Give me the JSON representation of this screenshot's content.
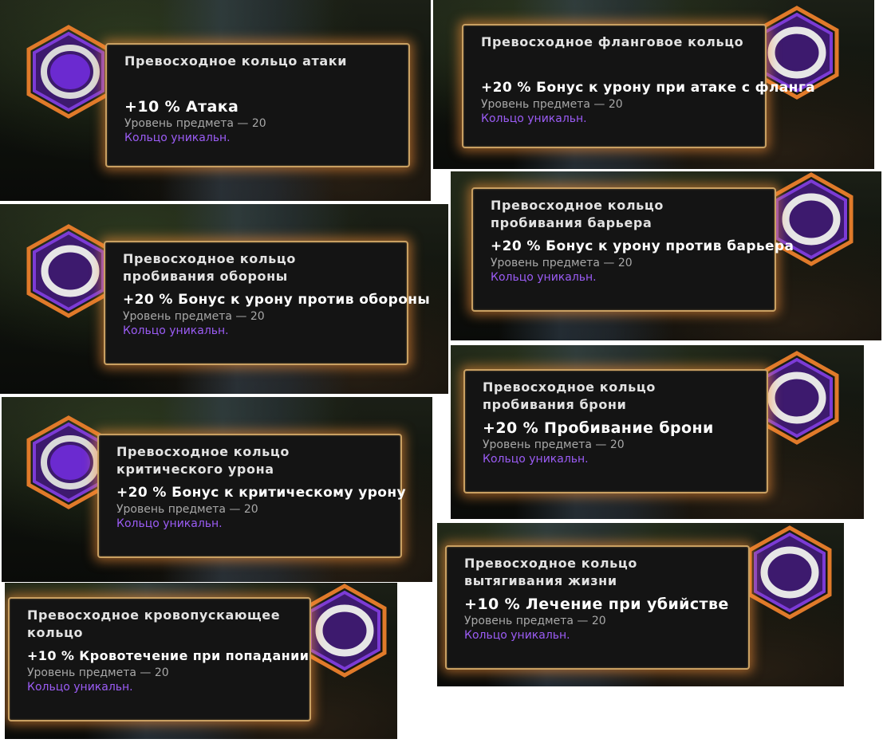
{
  "tooltips": [
    {
      "name": "Превосходное кольцо атаки",
      "bonus": "+10 % Атака",
      "level": "Уровень предмета — 20",
      "uniq": "Кольцо уникальн.",
      "ring": "purple"
    },
    {
      "name": "Превосходное фланговое кольцо",
      "bonus": "+20 % Бонус к урону при атаке с фланга",
      "level": "Уровень предмета — 20",
      "uniq": "Кольцо уникальн.",
      "ring": "silver"
    },
    {
      "name": "Превосходное кольцо пробивания барьера",
      "bonus": "+20 % Бонус к урону против барьера",
      "level": "Уровень предмета — 20",
      "uniq": "Кольцо уникальн.",
      "ring": "silver"
    },
    {
      "name": "Превосходное кольцо пробивания обороны",
      "bonus": "+20 % Бонус к урону против обороны",
      "level": "Уровень предмета — 20",
      "uniq": "Кольцо уникальн.",
      "ring": "silver"
    },
    {
      "name": "Превосходное кольцо пробивания брони",
      "bonus": "+20 % Пробивание брони",
      "level": "Уровень предмета — 20",
      "uniq": "Кольцо уникальн.",
      "ring": "silver"
    },
    {
      "name": "Превосходное кольцо критического урона",
      "bonus": "+20 % Бонус к критическому урону",
      "level": "Уровень предмета — 20",
      "uniq": "Кольцо уникальн.",
      "ring": "purple"
    },
    {
      "name": "Превосходное кольцо вытягивания жизни",
      "bonus": "+10 % Лечение при убийстве",
      "level": "Уровень предмета — 20",
      "uniq": "Кольцо уникальн.",
      "ring": "silver"
    },
    {
      "name": "Превосходное кровопускающее кольцо",
      "bonus": "+10 % Кровотечение при попадании",
      "level": "Уровень предмета — 20",
      "uniq": "Кольцо уникальн.",
      "ring": "silver"
    }
  ],
  "colors": {
    "hex_fill": "#3d1a6e",
    "hex_border": "#7c3bd6",
    "hex_outer": "#e07a2a",
    "tooltip_border": "#c9a062",
    "unique_text": "#9b5cf5"
  }
}
